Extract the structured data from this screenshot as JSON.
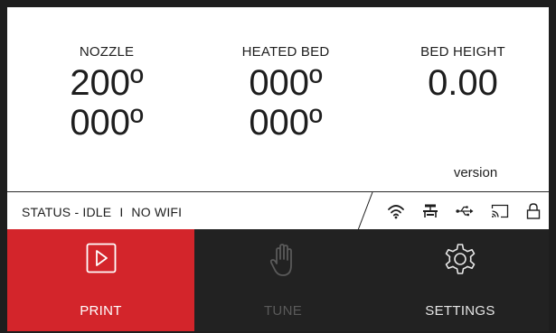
{
  "readouts": {
    "nozzle": {
      "label": "NOZZLE",
      "current": "200º",
      "target": "000º"
    },
    "heated_bed": {
      "label": "HEATED BED",
      "current": "000º",
      "target": "000º"
    },
    "bed_height": {
      "label": "BED HEIGHT",
      "value": "0.00"
    }
  },
  "version_label": "version",
  "status": {
    "state": "STATUS - IDLE",
    "separator": "I",
    "network": "NO WIFI"
  },
  "status_icons": [
    "wifi-icon",
    "printer-icon",
    "usb-icon",
    "cast-icon",
    "lock-icon"
  ],
  "nav": {
    "print": {
      "label": "PRINT",
      "icon": "play-icon",
      "active": true
    },
    "tune": {
      "label": "TUNE",
      "icon": "hand-icon",
      "disabled": true
    },
    "settings": {
      "label": "SETTINGS",
      "icon": "gear-icon"
    }
  },
  "colors": {
    "frame": "#1e1e1e",
    "nav_background": "#222222",
    "active_tab": "#d3252b",
    "disabled_text": "#5a5a5a"
  }
}
